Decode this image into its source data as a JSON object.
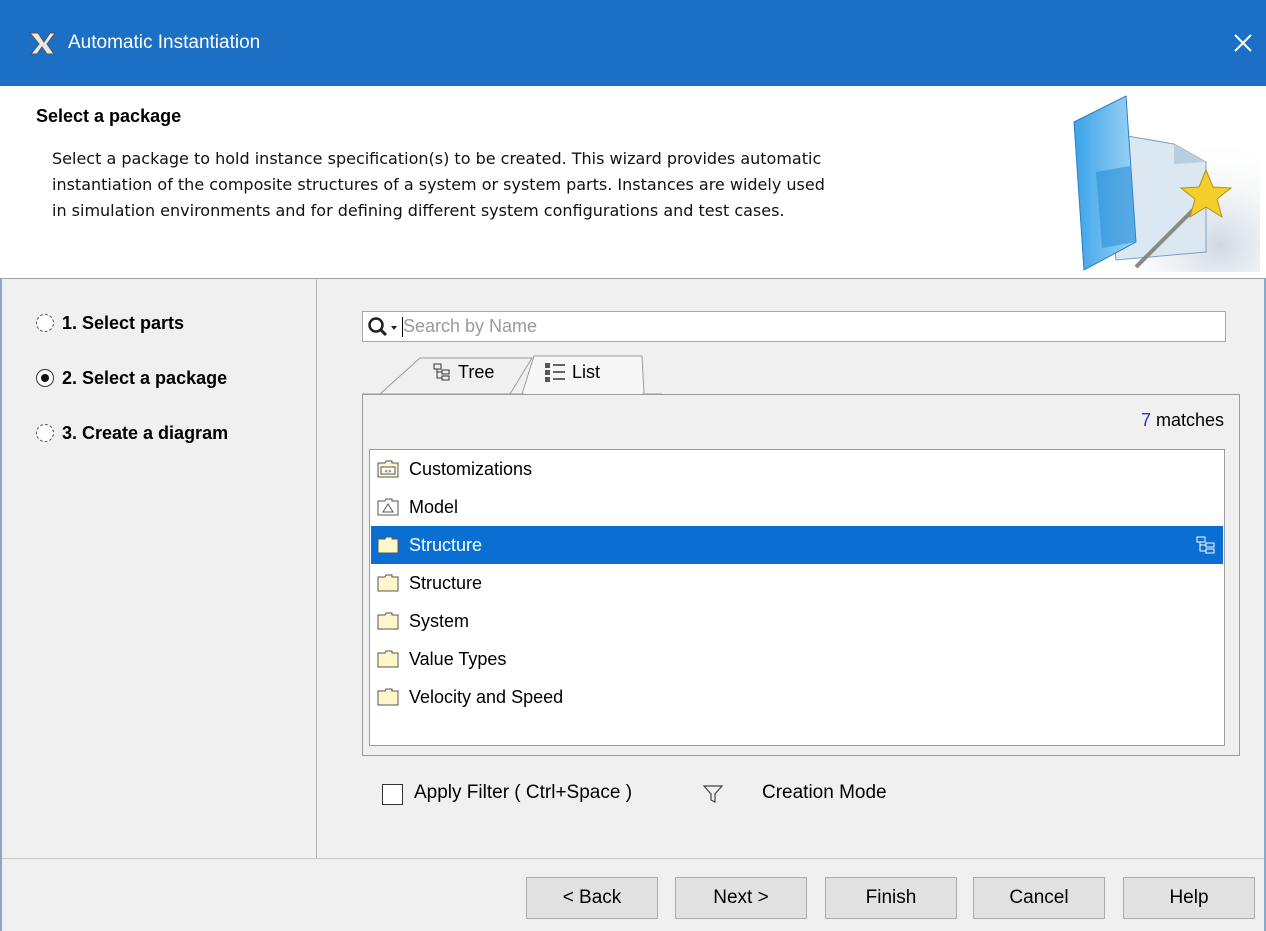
{
  "window": {
    "title": "Automatic Instantiation"
  },
  "header": {
    "title": "Select a package",
    "description_lines": [
      "Select a package to hold instance specification(s) to be created. This wizard provides automatic",
      "instantiation of the composite structures of a system or system parts. Instances are widely used",
      "in simulation environments and for defining different system configurations and test cases."
    ]
  },
  "steps": [
    {
      "label": "1. Select parts",
      "selected": false
    },
    {
      "label": "2. Select a package",
      "selected": true
    },
    {
      "label": "3. Create a diagram",
      "selected": false
    }
  ],
  "search": {
    "placeholder": "Search by Name",
    "value": ""
  },
  "tabs": [
    {
      "label": "Tree",
      "icon": "tree-icon",
      "active": false
    },
    {
      "label": "List",
      "icon": "list-icon",
      "active": true
    }
  ],
  "matches": {
    "count": "7",
    "suffix": " matches"
  },
  "list_items": [
    {
      "label": "Customizations",
      "icon": "customization-package-icon",
      "selected": false
    },
    {
      "label": "Model",
      "icon": "model-icon",
      "selected": false
    },
    {
      "label": "Structure",
      "icon": "package-icon",
      "selected": true
    },
    {
      "label": "Structure",
      "icon": "package-icon",
      "selected": false
    },
    {
      "label": "System",
      "icon": "package-icon",
      "selected": false
    },
    {
      "label": "Value Types",
      "icon": "package-icon",
      "selected": false
    },
    {
      "label": "Velocity and Speed",
      "icon": "package-icon",
      "selected": false
    }
  ],
  "filter": {
    "label": "Apply Filter ( Ctrl+Space )",
    "checked": false
  },
  "creation_mode": {
    "label": "Creation Mode"
  },
  "buttons": {
    "back": "< Back",
    "next": "Next >",
    "finish": "Finish",
    "cancel": "Cancel",
    "help": "Help"
  },
  "colors": {
    "titlebar": "#1b6fc4",
    "selection": "#0a6fd3",
    "match_count": "#2437d8"
  }
}
